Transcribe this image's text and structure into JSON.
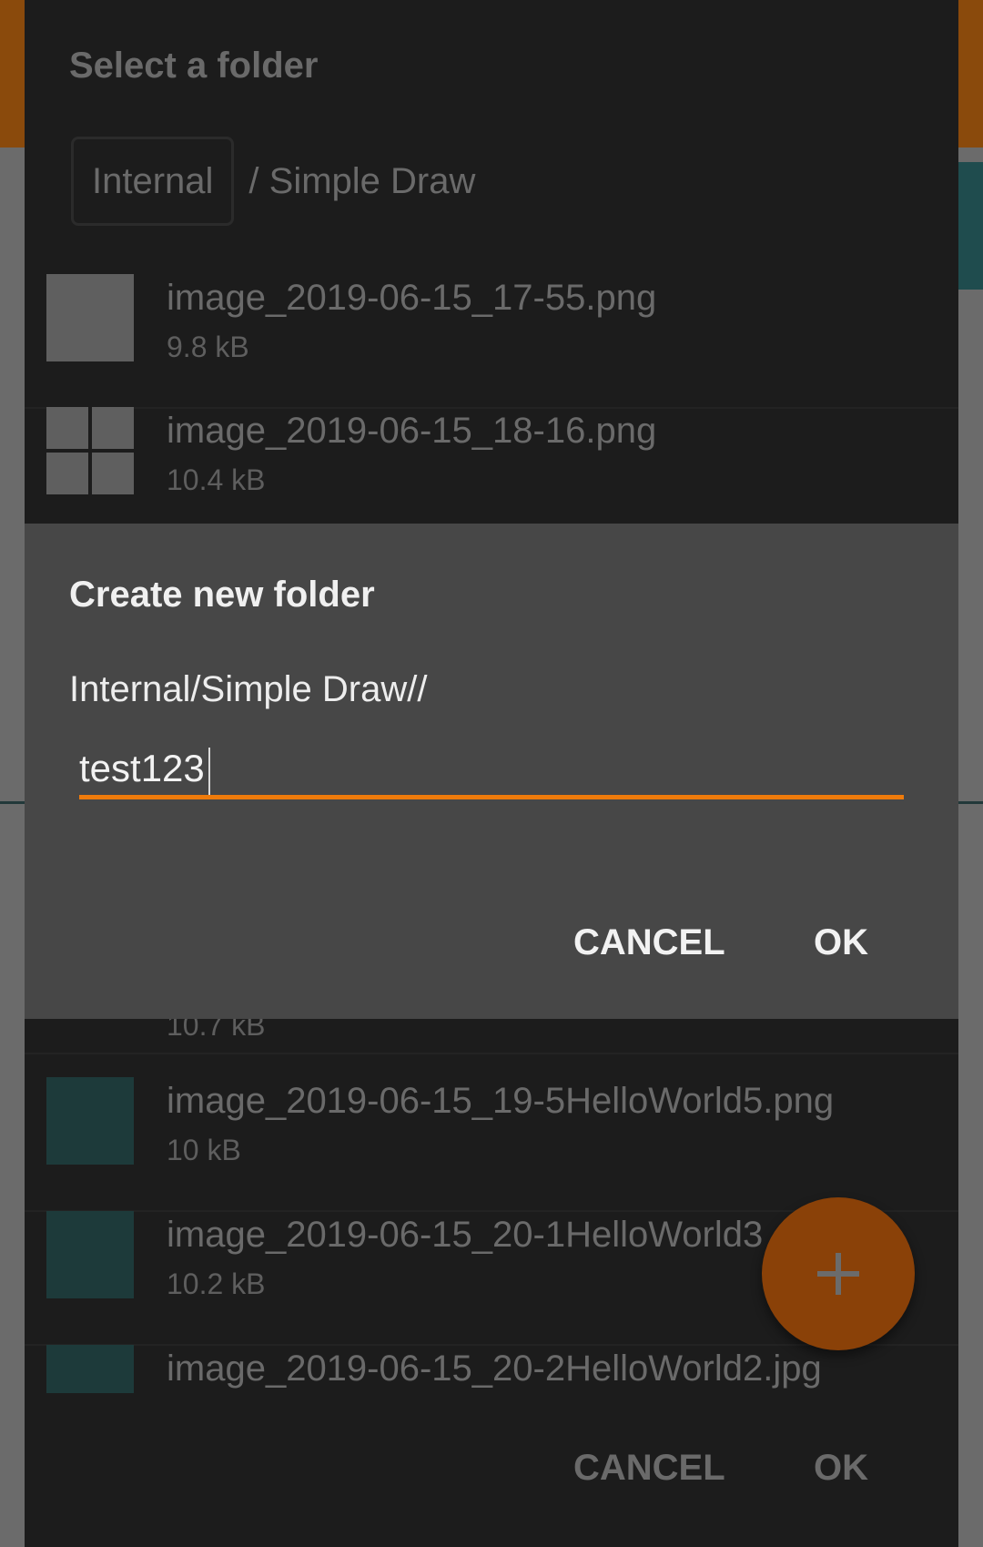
{
  "chooser": {
    "title": "Select a folder",
    "breadcrumb": {
      "root": "Internal",
      "path": "/ Simple Draw"
    },
    "files": [
      {
        "name": "image_2019-06-15_17-55.png",
        "size": "9.8 kB"
      },
      {
        "name": "image_2019-06-15_18-16.png",
        "size": "10.4 kB"
      },
      {
        "name": "",
        "size": "10.7 kB"
      },
      {
        "name": "image_2019-06-15_19-5HelloWorld5.png",
        "size": "10 kB"
      },
      {
        "name": "image_2019-06-15_20-1HelloWorld3",
        "size": "10.2 kB"
      },
      {
        "name": "image_2019-06-15_20-2HelloWorld2.jpg",
        "size": ""
      }
    ],
    "cancel_label": "CANCEL",
    "ok_label": "OK"
  },
  "fab": {
    "icon": "plus-icon"
  },
  "create_dialog": {
    "title": "Create new folder",
    "path": "Internal/Simple Draw//",
    "input_value": "test123",
    "cancel_label": "CANCEL",
    "ok_label": "OK"
  },
  "colors": {
    "accent": "#ef7b0b",
    "fab": "#8a4108",
    "dialog_bg": "#474747",
    "chooser_bg": "#1c1c1c"
  }
}
